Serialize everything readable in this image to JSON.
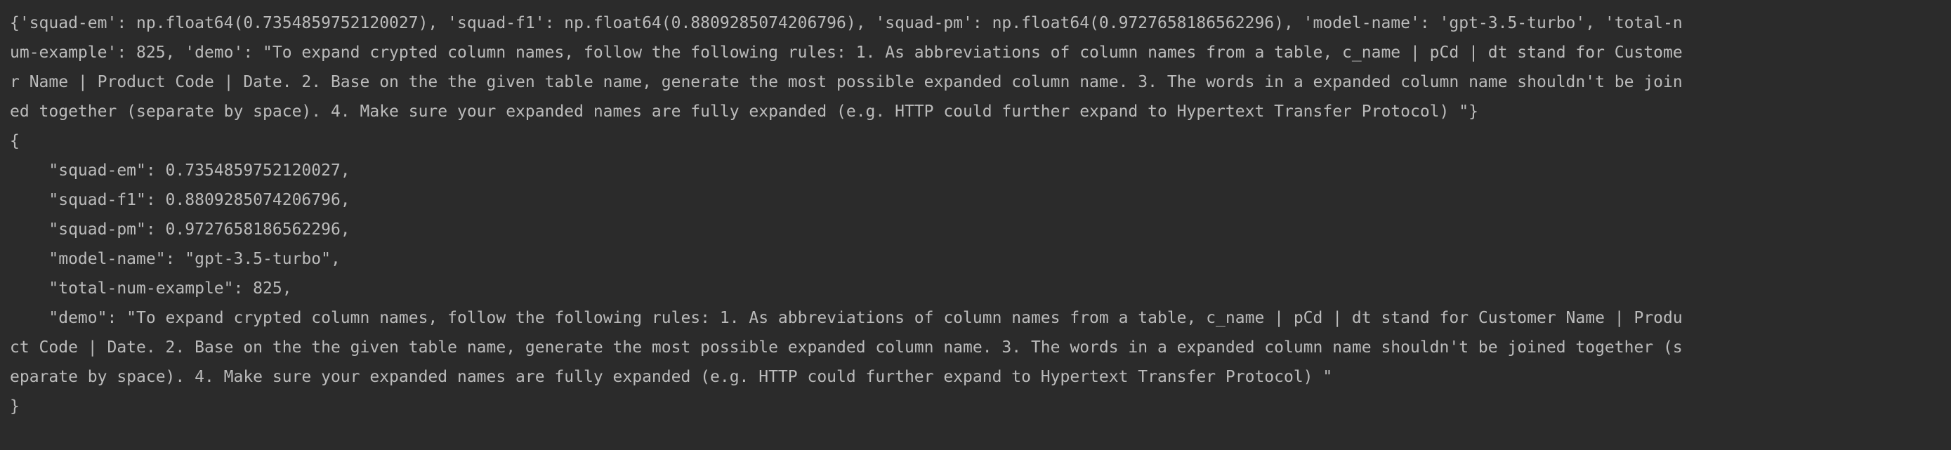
{
  "console": {
    "lines": [
      "{'squad-em': np.float64(0.7354859752120027), 'squad-f1': np.float64(0.8809285074206796), 'squad-pm': np.float64(0.9727658186562296), 'model-name': 'gpt-3.5-turbo', 'total-n",
      "um-example': 825, 'demo': \"To expand crypted column names, follow the following rules: 1. As abbreviations of column names from a table, c_name | pCd | dt stand for Custome",
      "r Name | Product Code | Date. 2. Base on the the given table name, generate the most possible expanded column name. 3. The words in a expanded column name shouldn't be join",
      "ed together (separate by space). 4. Make sure your expanded names are fully expanded (e.g. HTTP could further expand to Hypertext Transfer Protocol) \"}",
      "{",
      "    \"squad-em\": 0.7354859752120027,",
      "    \"squad-f1\": 0.8809285074206796,",
      "    \"squad-pm\": 0.9727658186562296,",
      "    \"model-name\": \"gpt-3.5-turbo\",",
      "    \"total-num-example\": 825,",
      "    \"demo\": \"To expand crypted column names, follow the following rules: 1. As abbreviations of column names from a table, c_name | pCd | dt stand for Customer Name | Produ",
      "ct Code | Date. 2. Base on the the given table name, generate the most possible expanded column name. 3. The words in a expanded column name shouldn't be joined together (s",
      "eparate by space). 4. Make sure your expanded names are fully expanded (e.g. HTTP could further expand to Hypertext Transfer Protocol) \"",
      "}"
    ]
  }
}
